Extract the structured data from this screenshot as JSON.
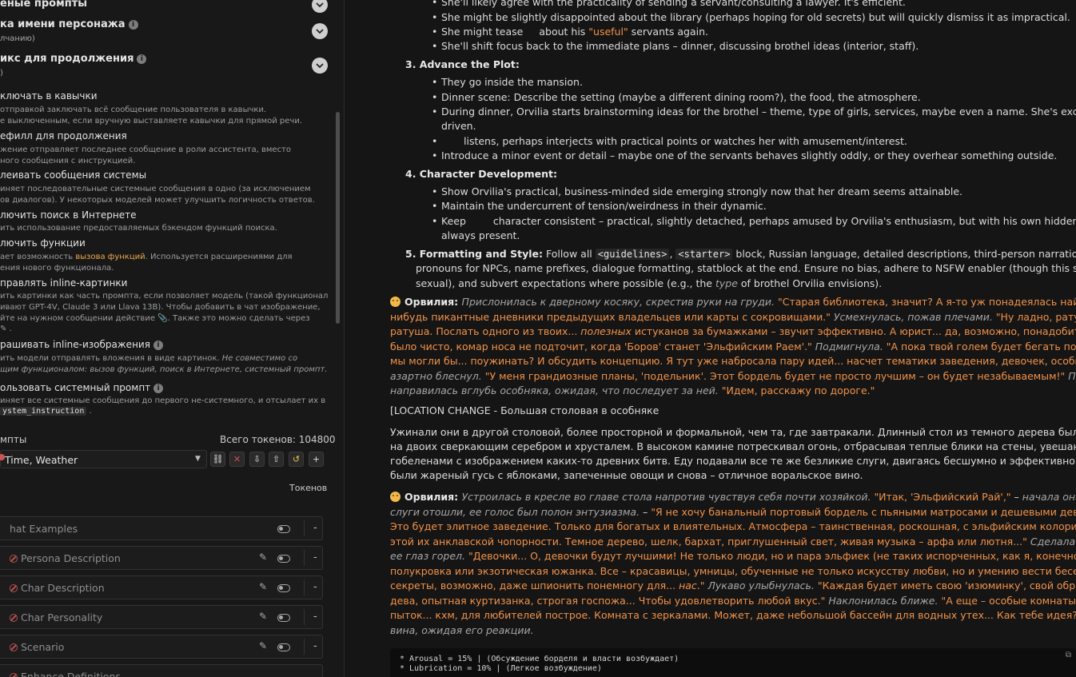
{
  "left": {
    "sections": [
      {
        "title": "еные промпты",
        "sub": ""
      },
      {
        "title": "ка имени персонажа",
        "sub": "лчанию)"
      },
      {
        "title": "икс для продолжения",
        "sub": ")"
      }
    ],
    "options": [
      {
        "title": "ключать в кавычки",
        "desc": [
          "отправкой заключать всё сообщение пользователя в кавычки.",
          "е выключенным, если вручную выставляете кавычки для прямой речи."
        ]
      },
      {
        "title": "ефилл для продолжения",
        "desc": [
          "жение отправляет последнее сообщение в роли ассистента, вместо",
          "ного сообщения с инструкцией."
        ]
      },
      {
        "title": "леивать сообщения системы",
        "desc": [
          "иняет последовательные системные сообщения в одно (за исключением",
          "ов диалогов). У некоторых моделей может улучшить логичность ответов."
        ]
      },
      {
        "title": "лючить поиск в Интернете",
        "desc": [
          "ить использование предоставляемых бэкендом функций поиска."
        ]
      },
      {
        "title": "лючить функции",
        "desc_pre": "ает возможность ",
        "desc_link": "вызова функций",
        "desc_post": ". Используется расширениями для",
        "desc2": "ения нового функционала."
      },
      {
        "title": "правлять inline-картинки",
        "desc": [
          "ить картинки как часть промпта, если позволяет модель (такой функционал",
          "ивают GPT-4V, Claude 3 или Llava 13B). Чтобы добавить в чат изображение,",
          "йте на нужном сообщении действие",
          "."
        ],
        "desc3_post": ". Также это можно сделать через"
      },
      {
        "title": "рашивать inline-изображения",
        "desc1_pre": "ить модели отправлять вложения в виде картинок. ",
        "desc1_it": "Не совместимо со",
        "desc2_it": "щим функционалом: вызов функций, поиск в Интернете, системный промпт."
      },
      {
        "title": "ользовать системный промпт",
        "desc": [
          "иняет все системные сообщения до первого не-системного, и отсылает их в"
        ],
        "code": "ystem_instruction"
      }
    ],
    "prompts_label": "мпты",
    "total_tokens": "Всего токенов: 104800",
    "preset_select": "Time, Weather",
    "tokens_col": "Токенов",
    "rows": [
      "hat Examples",
      "Persona Description",
      "Char Description",
      "Char Personality",
      "Scenario",
      "Enhance Definitions"
    ],
    "row_dash": "-"
  },
  "chat": {
    "l1": "She'll likely agree with the practicality of sending a servant/consulting a lawyer. It's efficient.",
    "l2": "She might be slightly disappointed about the library (perhaps hoping for old secrets) but will quickly dismiss it as impractical.",
    "l3a": "She might tease",
    "l3b": "about his ",
    "l3q": "\"useful\"",
    "l3c": " servants again.",
    "l4": "She'll shift focus back to the immediate plans – dinner, discussing brothel ideas (interior, staff).",
    "h3": "3. Advance the Plot:",
    "p1": "They go inside the mansion.",
    "p2": "Dinner scene: Describe the setting (maybe a different dining room?), the food, the atmosphere.",
    "p3a": "During dinner, Orvilia starts brainstorming ideas for the brothel – theme, type of girls, services, maybe even a name. She's excited and",
    "p3b": "driven.",
    "p4": "listens, perhaps interjects with practical points or watches her with amusement/interest.",
    "p5": "Introduce a minor event or detail – maybe one of the servants behaves slightly oddly, or they overhear something outside.",
    "h4": "4. Character Development:",
    "c1": "Show Orvilia's practical, business-minded side emerging strongly now that her dream seems attainable.",
    "c2": "Maintain the undercurrent of tension/weirdness in their dynamic.",
    "c3a": "Keep",
    "c3b": "character consistent – practical, slightly detached, perhaps amused by Orvilia's enthusiasm, but with his own hidden agenda",
    "c3c": "always present.",
    "h5": "5. Formatting and Style:",
    "f1a": " Follow all ",
    "f1code1": "<guidelines>",
    "f1sep": ", ",
    "f1code2": "<starter>",
    "f1b": " block, Russian language, detailed descriptions, third-person narration without",
    "f2": "pronouns for NPCs, name prefixes, dialogue formatting, statblock at the end. Ensure no bias, adhere to NSFW enabler (though this scene is non-",
    "f3a": "sexual), and subvert expectations where possible (e.g., the ",
    "f3it": "type",
    "f3b": " of brothel Orvilia envisions).",
    "name": "Орвилия:",
    "m1": [
      [
        {
          "i": "Прислонилась к дверному косяку, скрестив руки на груди. "
        },
        {
          "q": "\"Старая библиотека, значит? А я-то уж понадеялась найти там какие-"
        }
      ],
      [
        {
          "q": "нибудь пикантные дневники предыдущих владельцев или карты с сокровищами.\""
        },
        {
          "i": " Усмехнулась, пожав плечами. "
        },
        {
          "q": "\"Ну ладно, ратуша так"
        }
      ],
      [
        {
          "q": "ратуша. Послать одного из твоих... "
        },
        {
          "qi": "полезных"
        },
        {
          "q": " истуканов за бумажками – звучит эффективно. А юрист... да, возможно, понадобится. Чтобы все"
        }
      ],
      [
        {
          "q": "было чисто, комар носа не подточит, когда 'Боров' станет 'Эльфийским Раем'.\""
        },
        {
          "i": " Подмигнула. "
        },
        {
          "q": "\"А пока твой голем будет бегать по поручениям,"
        }
      ],
      [
        {
          "q": "мы могли бы... поужинать? И обсудить концепцию. Я тут уже набросала пару идей... насчет тематики заведения, девочек, особых услуг...\""
        },
        {
          "i": " Глаза"
        }
      ],
      [
        {
          "i": "азартно блеснул. "
        },
        {
          "q": "\"У меня грандиозные планы, 'подельник'. Этот бордель будет не просто лучшим – он будет незабываемым!\""
        },
        {
          "i": " Повернулась и"
        }
      ],
      [
        {
          "i": "направилась вглубь особняка, ожидая, что              последует за ней. "
        },
        {
          "q": "\"Идем, расскажу по дороге.\""
        }
      ]
    ],
    "loc": "[LOCATION CHANGE - Большая столовая в особняке",
    "d1": "Ужинали они в другой столовой, более просторной и формальной, чем та, где завтракали. Длинный стол из темного дерева был сервирован",
    "d2": "на двоих сверкающим серебром и хрусталем. В высоком камине потрескивал огонь, отбрасывая теплые блики на стены, увешанные",
    "d3": "гобеленами с изображением каких-то древних битв. Еду подавали все те же безликие слуги, двигаясь бесшумно и эффективно. На этот раз",
    "d4": "были жареный гусь с яблоками, запеченные овощи и снова – отличное воральское вино.",
    "m2": [
      [
        {
          "i": "Устроилась в кресле во главе стола напротив              чувствуя себя почти хозяйкой. "
        },
        {
          "q": "\"Итак, 'Эльфийский Рай',\""
        },
        {
          "n": " – "
        },
        {
          "i": "начала она, едва"
        }
      ],
      [
        {
          "i": "слуги отошли, ее голос был полон энтузиазма. "
        },
        {
          "n": "– "
        },
        {
          "q": "\"Я не хочу банальный портовый бордель с пьяными матросами и дешевыми девками. Нет!"
        }
      ],
      [
        {
          "q": "Это будет элитное заведение. Только для богатых и влиятельных. Атмосфера – таинственная, роскошная, с эльфийским колоритом, но без"
        }
      ],
      [
        {
          "q": "этой их анклавской чопорности. Темное дерево, шелк, бархат, приглушенный свет, живая музыка – арфа или лютня...\""
        },
        {
          "i": " Сделала глоток вина,"
        }
      ],
      [
        {
          "i": "ее глаз горел. "
        },
        {
          "q": "\"Девочки... О, девочки будут лучшими! Не только люди, но и пара эльфиек (не таких испорченных, как я, конечно), может, даже"
        }
      ],
      [
        {
          "q": "полукровка или экзотическая южанка. Все – красавицы, умницы, обученные не только искусству любви, но и умению вести беседу, хранить"
        }
      ],
      [
        {
          "q": "секреты, возможно, даже шпионить понемногу для... "
        },
        {
          "qi": "нас"
        },
        {
          "q": ".\""
        },
        {
          "i": " Лукаво улыбнулась. "
        },
        {
          "q": "\"Каждая будет иметь свою 'изюминку', свой образ. Невинная"
        }
      ],
      [
        {
          "q": "дева, опытная куртизанка, строгая госпожа... Чтобы удовлетворить любой вкус.\""
        },
        {
          "i": " Наклонилась ближе. "
        },
        {
          "q": "\"А еще – особые комнаты. Комната для"
        }
      ],
      [
        {
          "q": "пыток... кхм, для любителей построе. Комната с зеркалами. Может, даже небольшой бассейн для водных утех... Как тебе идея?\""
        },
        {
          "i": " Отпила еще"
        }
      ],
      [
        {
          "i": "вина, ожидая его реакции."
        }
      ]
    ],
    "code": [
      "* Arousal = 15% | (Обсуждение борделя и власти возбуждает)",
      "* Lubrication = 10% | (Легкое возбуждение)"
    ]
  }
}
